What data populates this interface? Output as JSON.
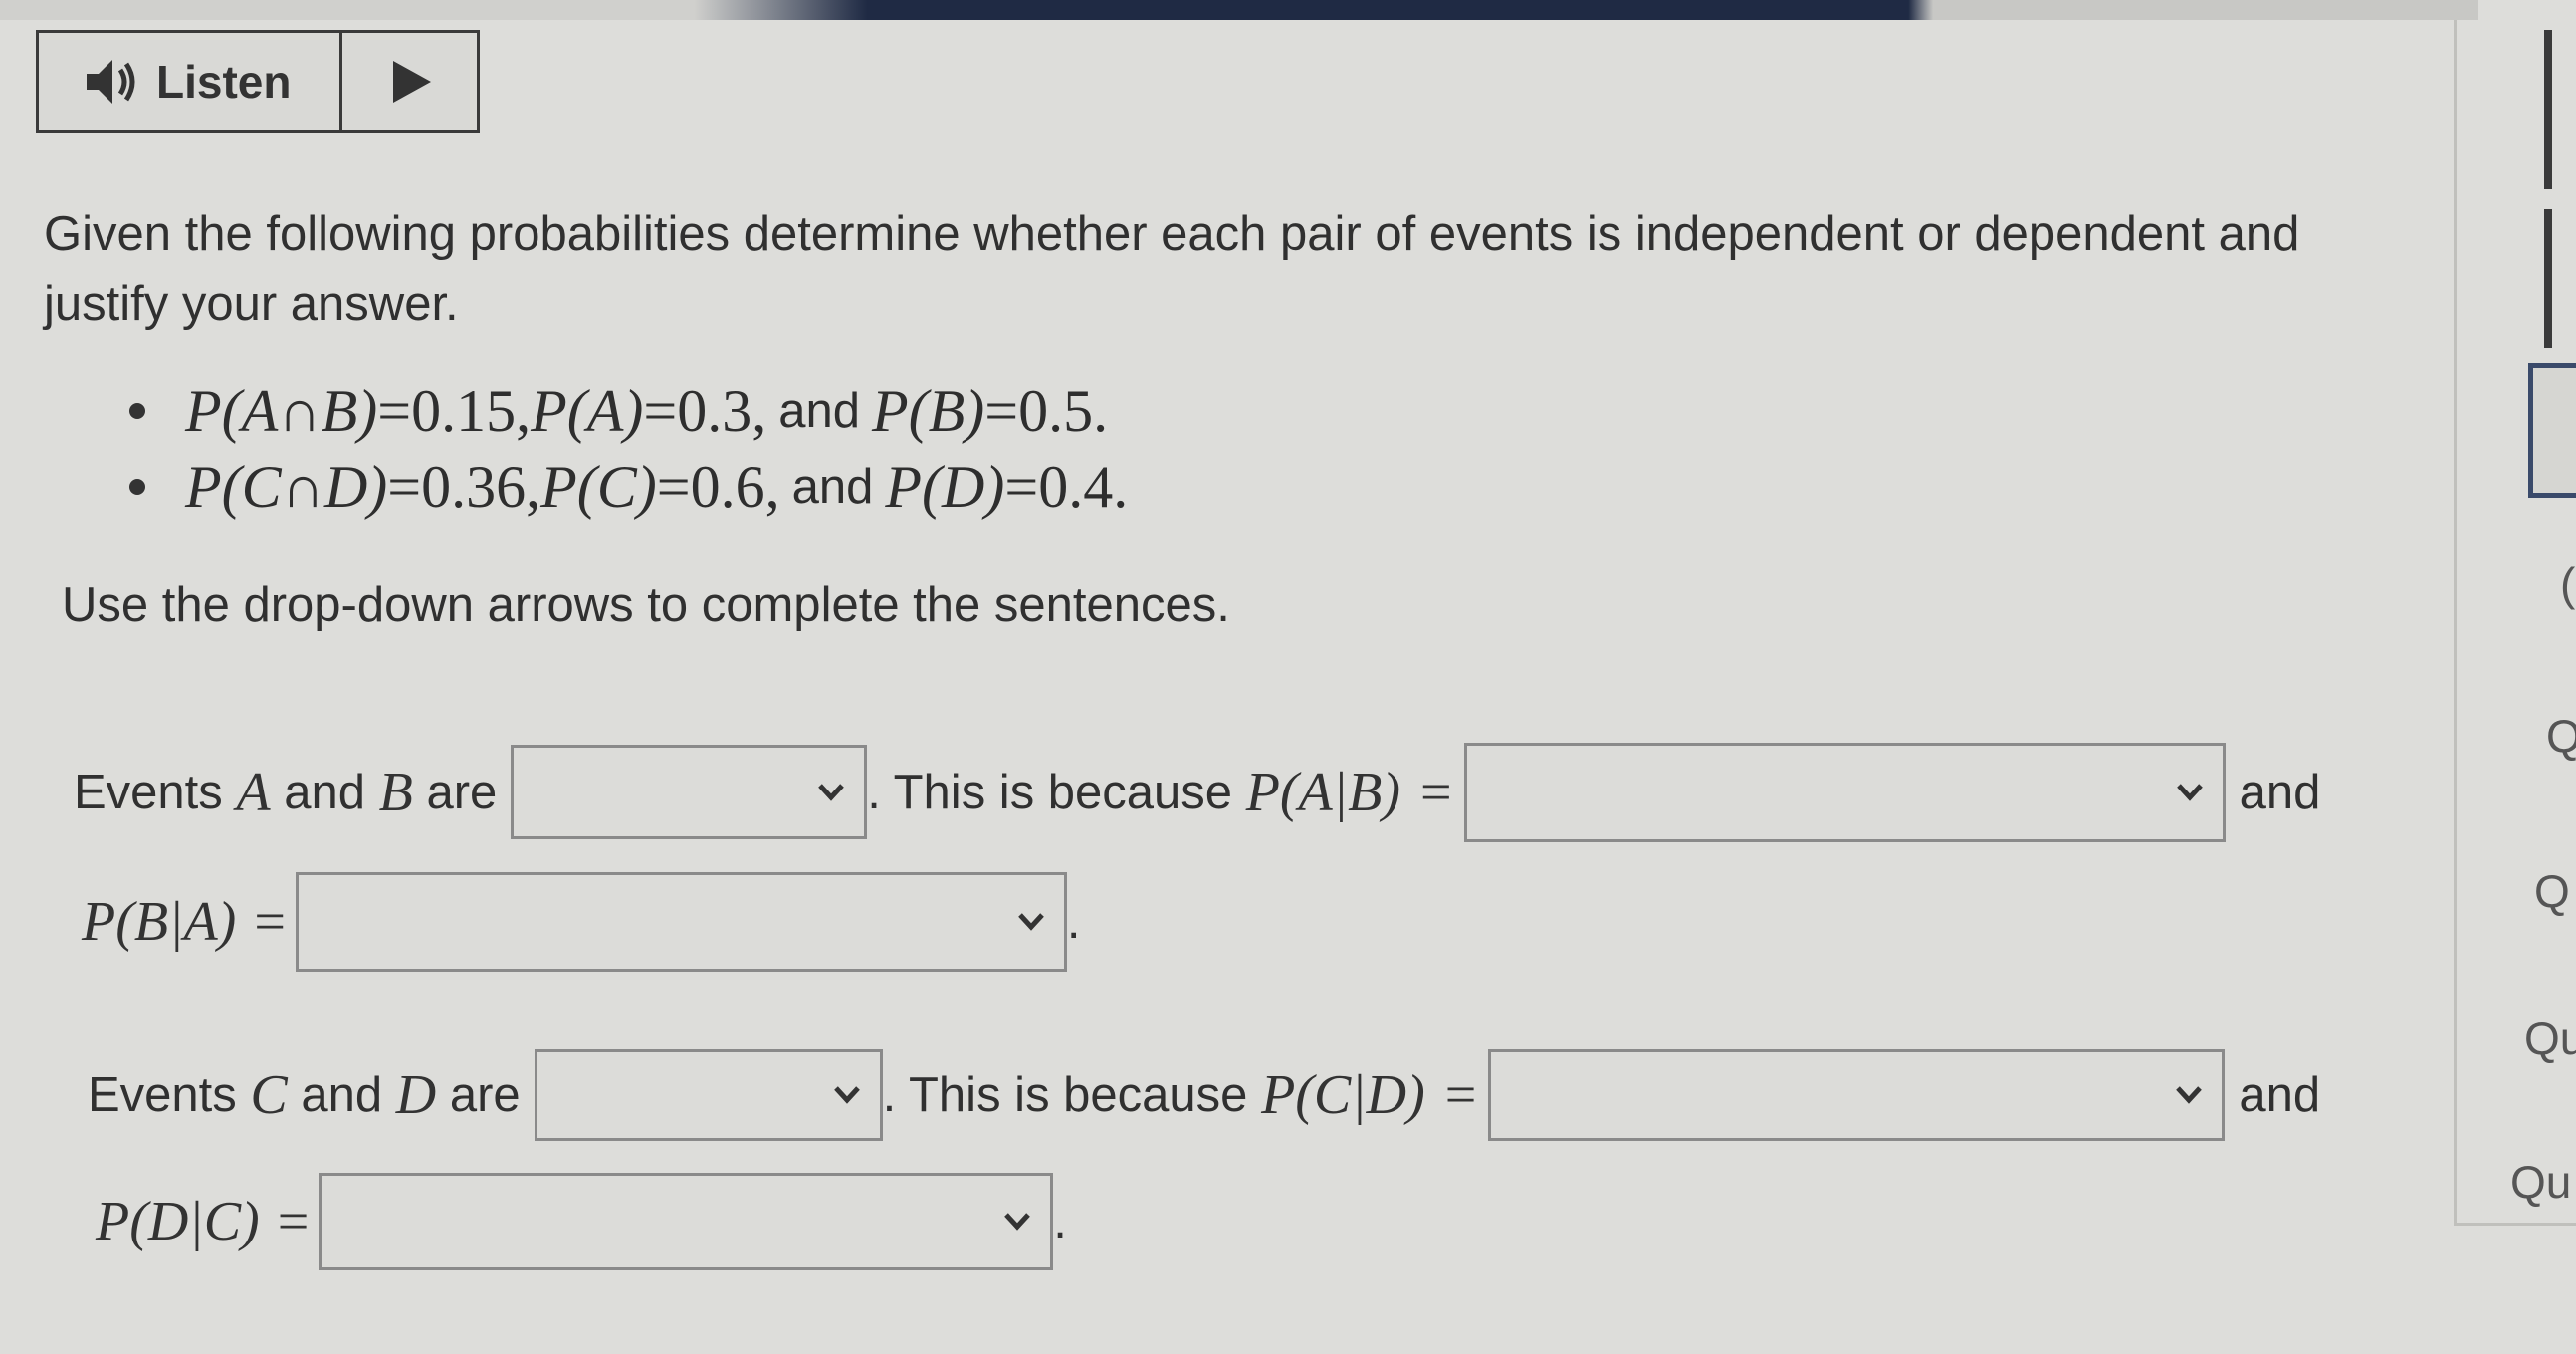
{
  "toolbar": {
    "listen_label": "Listen"
  },
  "instructions": "Given the following probabilities determine whether each pair of events is independent or dependent and justify your answer.",
  "bullets": [
    {
      "p1_lhs": "P(A∩B)",
      "p1_val": "0.15",
      "p2_lhs": "P(A)",
      "p2_val": "0.3",
      "and": "and",
      "p3_lhs": "P(B)",
      "p3_val": "0.5"
    },
    {
      "p1_lhs": "P(C∩D)",
      "p1_val": "0.36",
      "p2_lhs": "P(C)",
      "p2_val": "0.6",
      "and": "and",
      "p3_lhs": "P(D)",
      "p3_val": "0.4"
    }
  ],
  "directions": "Use the drop-down arrows to complete the sentences.",
  "sentence_ab": {
    "prefix_1": "Events ",
    "var_1": "A",
    "mid_1": " and ",
    "var_2": "B",
    "suffix_1": " are",
    "because": ". This is because ",
    "cond_1": "P(A|B)",
    "and": "and",
    "cond_2": "P(B|A)",
    "equals": "=",
    "end": "."
  },
  "sentence_cd": {
    "prefix_1": "Events ",
    "var_1": "C",
    "mid_1": " and ",
    "var_2": "D",
    "suffix_1": " are",
    "because": ". This is because ",
    "cond_1": "P(C|D)",
    "and": "and",
    "cond_2": "P(D|C)",
    "equals": "=",
    "end": "."
  },
  "dropdowns": {
    "ab_relation": "",
    "ab_cond_1": "",
    "ab_cond_2": "",
    "cd_relation": "",
    "cd_cond_1": "",
    "cd_cond_2": ""
  },
  "sidebar_fragments": [
    "(",
    "Q",
    "Q",
    "Qu",
    "Qu"
  ]
}
